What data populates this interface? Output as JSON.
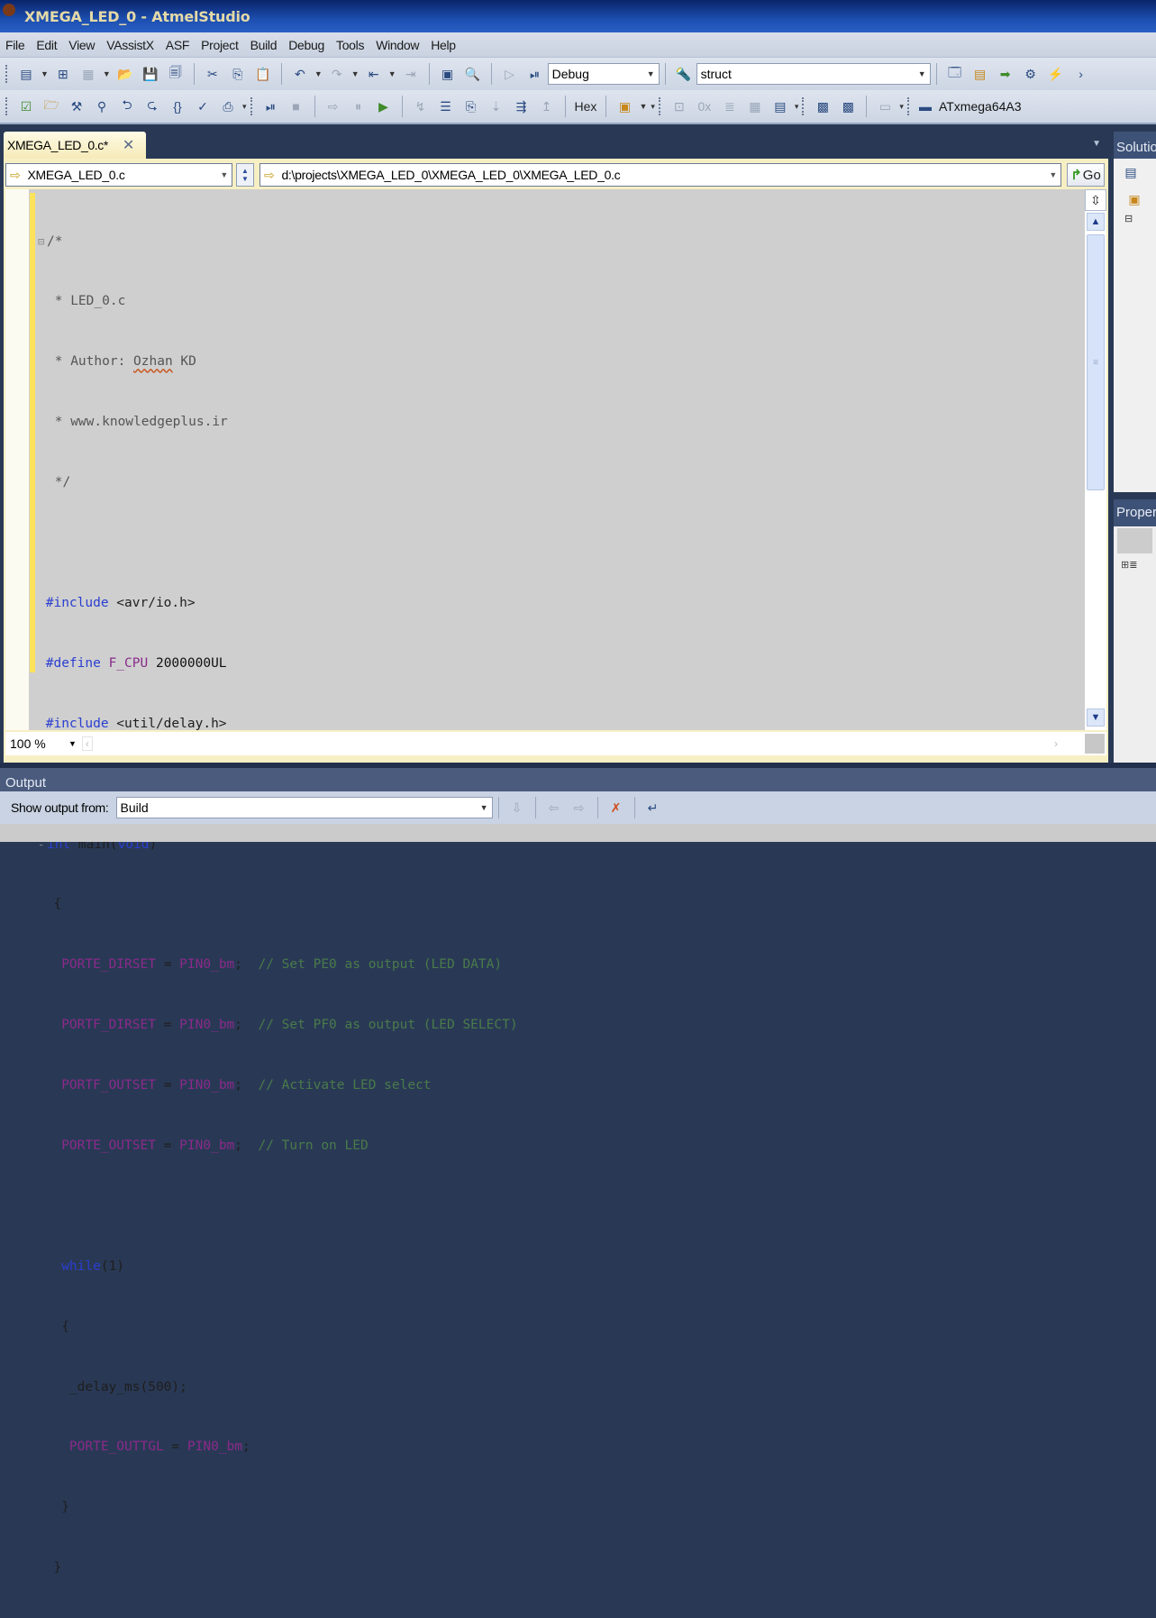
{
  "window": {
    "title": "XMEGA_LED_0 - AtmelStudio"
  },
  "menu": [
    "File",
    "Edit",
    "View",
    "VAssistX",
    "ASF",
    "Project",
    "Build",
    "Debug",
    "Tools",
    "Window",
    "Help"
  ],
  "toolbar": {
    "configuration": "Debug",
    "find_value": "struct",
    "hex_label": "Hex",
    "device": "ATxmega64A3",
    "go_label": "Go"
  },
  "document": {
    "tab_label": "XMEGA_LED_0.c*",
    "file_combo": "XMEGA_LED_0.c",
    "path_combo": "d:\\projects\\XMEGA_LED_0\\XMEGA_LED_0\\XMEGA_LED_0.c",
    "zoom": "100 %"
  },
  "code": {
    "comment_open": "/*",
    "comment_file": " * LED_0.c",
    "comment_author_prefix": " * Author: ",
    "comment_author_name": "Ozhan",
    "comment_author_suffix": " KD",
    "comment_site": " * www.knowledgeplus.ir",
    "comment_close": " */",
    "inc1_kw": "#include",
    "inc1_rest": " <avr/io.h>",
    "def_kw": "#define",
    "def_name": " F_CPU",
    "def_value": " 2000000UL",
    "inc2_kw": "#include",
    "inc2_rest": " <util/delay.h>",
    "main_int": "int",
    "main_name": " main(",
    "main_void": "void",
    "main_close": ")",
    "brace_open": "{",
    "stmts": [
      {
        "reg": "PORTE_DIRSET",
        "val": "PIN0_bm",
        "comment": "// Set PE0 as output (LED DATA)"
      },
      {
        "reg": "PORTF_DIRSET",
        "val": "PIN0_bm",
        "comment": "// Set PF0 as output (LED SELECT)"
      },
      {
        "reg": "PORTF_OUTSET",
        "val": "PIN0_bm",
        "comment": "// Activate LED select"
      },
      {
        "reg": "PORTE_OUTSET",
        "val": "PIN0_bm",
        "comment": "// Turn on LED"
      }
    ],
    "while_kw": "while",
    "while_cond": "(1)",
    "inner_open": "{",
    "delay_call": "_delay_ms(500);",
    "toggle_reg": "PORTE_OUTTGL",
    "toggle_val": "PIN0_bm",
    "inner_close": "}",
    "brace_close": "}"
  },
  "panels": {
    "solution_title": "Solutio",
    "properties_title": "Proper"
  },
  "output": {
    "title": "Output",
    "show_from_label": "Show output from:",
    "source": "Build"
  }
}
